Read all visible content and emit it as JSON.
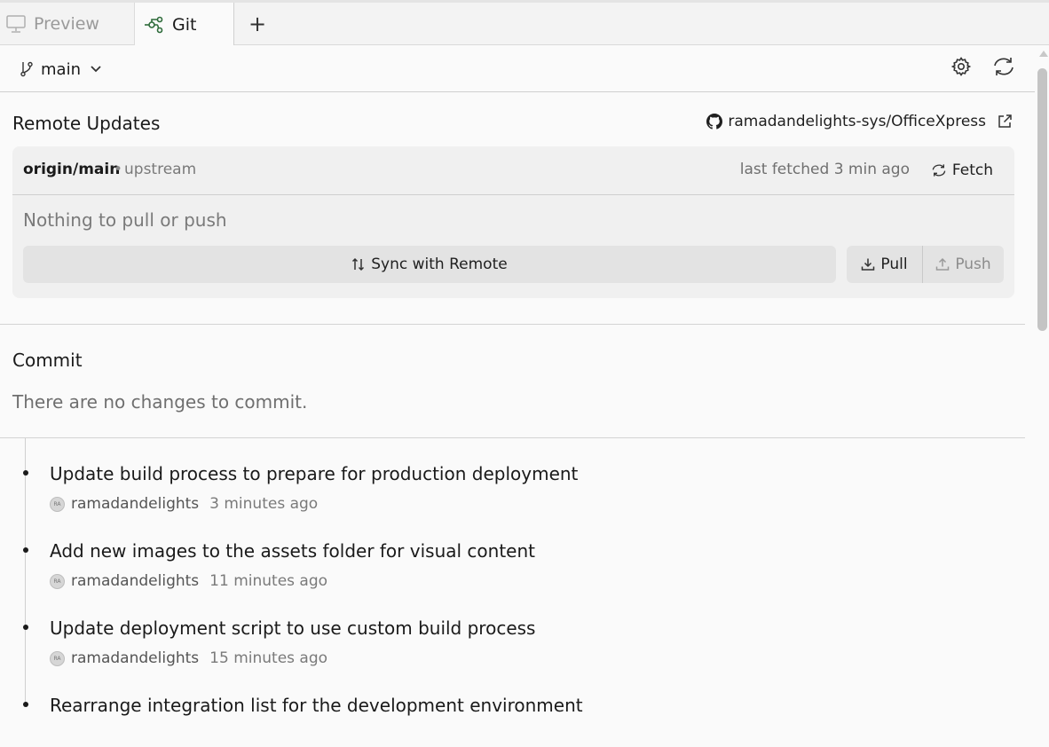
{
  "tabs": {
    "preview_label": "Preview",
    "git_label": "Git",
    "add_label": "+"
  },
  "branch": {
    "name": "main"
  },
  "remote": {
    "section_title": "Remote Updates",
    "repo": "ramadandelights-sys/OfficeXpress",
    "remote_name": "origin/main",
    "separator": "•",
    "remote_tag": "upstream",
    "last_fetched": "last fetched 3 min ago",
    "fetch_label": "Fetch",
    "status": "Nothing to pull or push",
    "sync_label": "Sync with Remote",
    "pull_label": "Pull",
    "push_label": "Push"
  },
  "commit": {
    "section_title": "Commit",
    "empty_message": "There are no changes to commit."
  },
  "history": [
    {
      "message": "Update build process to prepare for production deployment",
      "avatar": "RA",
      "author": "ramadandelights",
      "time": "3 minutes ago"
    },
    {
      "message": "Add new images to the assets folder for visual content",
      "avatar": "RA",
      "author": "ramadandelights",
      "time": "11 minutes ago"
    },
    {
      "message": "Update deployment script to use custom build process",
      "avatar": "RA",
      "author": "ramadandelights",
      "time": "15 minutes ago"
    },
    {
      "message": "Rearrange integration list for the development environment",
      "avatar": "",
      "author": "",
      "time": ""
    }
  ],
  "colors": {
    "accent_git": "#2e6b3a",
    "background": "#fafafa",
    "card": "#f0f0f0"
  },
  "icons": {
    "preview": "monitor-icon",
    "git": "git-commit-icon",
    "branch": "git-branch-icon",
    "settings": "gear-icon",
    "refresh": "refresh-icon",
    "github": "github-icon",
    "external": "external-link-icon",
    "fetch": "refresh-icon",
    "sync": "arrows-up-down-icon",
    "pull": "download-icon",
    "push": "upload-icon"
  }
}
